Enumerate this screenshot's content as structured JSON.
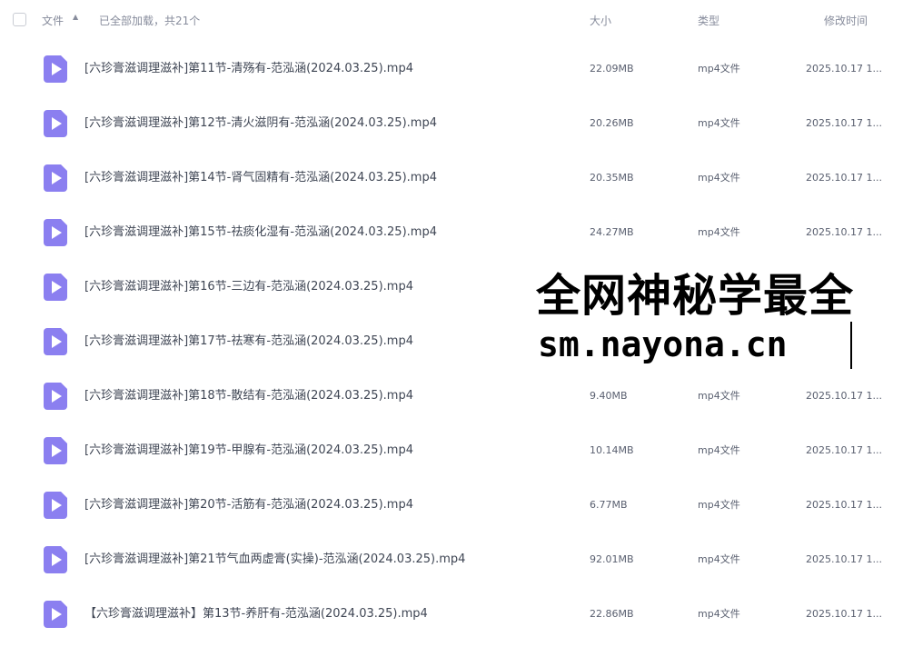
{
  "header": {
    "name_label": "文件",
    "sort_icon": "sort-ascending-icon",
    "status": "已全部加载，共21个",
    "size_label": "大小",
    "type_label": "类型",
    "time_label": "修改时间"
  },
  "files": [
    {
      "name": "[六珍膏滋调理滋补]第11节-清殇有-范泓涵(2024.03.25).mp4",
      "size": "22.09MB",
      "type": "mp4文件",
      "time": "2025.10.17 1..."
    },
    {
      "name": "[六珍膏滋调理滋补]第12节-清火滋阴有-范泓涵(2024.03.25).mp4",
      "size": "20.26MB",
      "type": "mp4文件",
      "time": "2025.10.17 1..."
    },
    {
      "name": "[六珍膏滋调理滋补]第14节-肾气固精有-范泓涵(2024.03.25).mp4",
      "size": "20.35MB",
      "type": "mp4文件",
      "time": "2025.10.17 1..."
    },
    {
      "name": "[六珍膏滋调理滋补]第15节-祛痰化湿有-范泓涵(2024.03.25).mp4",
      "size": "24.27MB",
      "type": "mp4文件",
      "time": "2025.10.17 1..."
    },
    {
      "name": "[六珍膏滋调理滋补]第16节-三边有-范泓涵(2024.03.25).mp4",
      "size": "",
      "type": "",
      "time": ""
    },
    {
      "name": "[六珍膏滋调理滋补]第17节-祛寒有-范泓涵(2024.03.25).mp4",
      "size": "",
      "type": "",
      "time": ""
    },
    {
      "name": "[六珍膏滋调理滋补]第18节-散结有-范泓涵(2024.03.25).mp4",
      "size": "9.40MB",
      "type": "mp4文件",
      "time": "2025.10.17 1..."
    },
    {
      "name": "[六珍膏滋调理滋补]第19节-甲腺有-范泓涵(2024.03.25).mp4",
      "size": "10.14MB",
      "type": "mp4文件",
      "time": "2025.10.17 1..."
    },
    {
      "name": "[六珍膏滋调理滋补]第20节-活筋有-范泓涵(2024.03.25).mp4",
      "size": "6.77MB",
      "type": "mp4文件",
      "time": "2025.10.17 1..."
    },
    {
      "name": "[六珍膏滋调理滋补]第21节气血两虚膏(实操)-范泓涵(2024.03.25).mp4",
      "size": "92.01MB",
      "type": "mp4文件",
      "time": "2025.10.17 1..."
    },
    {
      "name": "【六珍膏滋调理滋补】第13节-养肝有-范泓涵(2024.03.25).mp4",
      "size": "22.86MB",
      "type": "mp4文件",
      "time": "2025.10.17 1..."
    }
  ],
  "watermark": {
    "line1": "全网神秘学最全",
    "line2": "sm.nayona.cn"
  },
  "icons": {
    "file": "video-file-icon",
    "checkbox": "checkbox-icon"
  },
  "colors": {
    "file_icon": "#8b7ff0",
    "header_text": "#878c9c",
    "body_text": "#3f4654"
  }
}
